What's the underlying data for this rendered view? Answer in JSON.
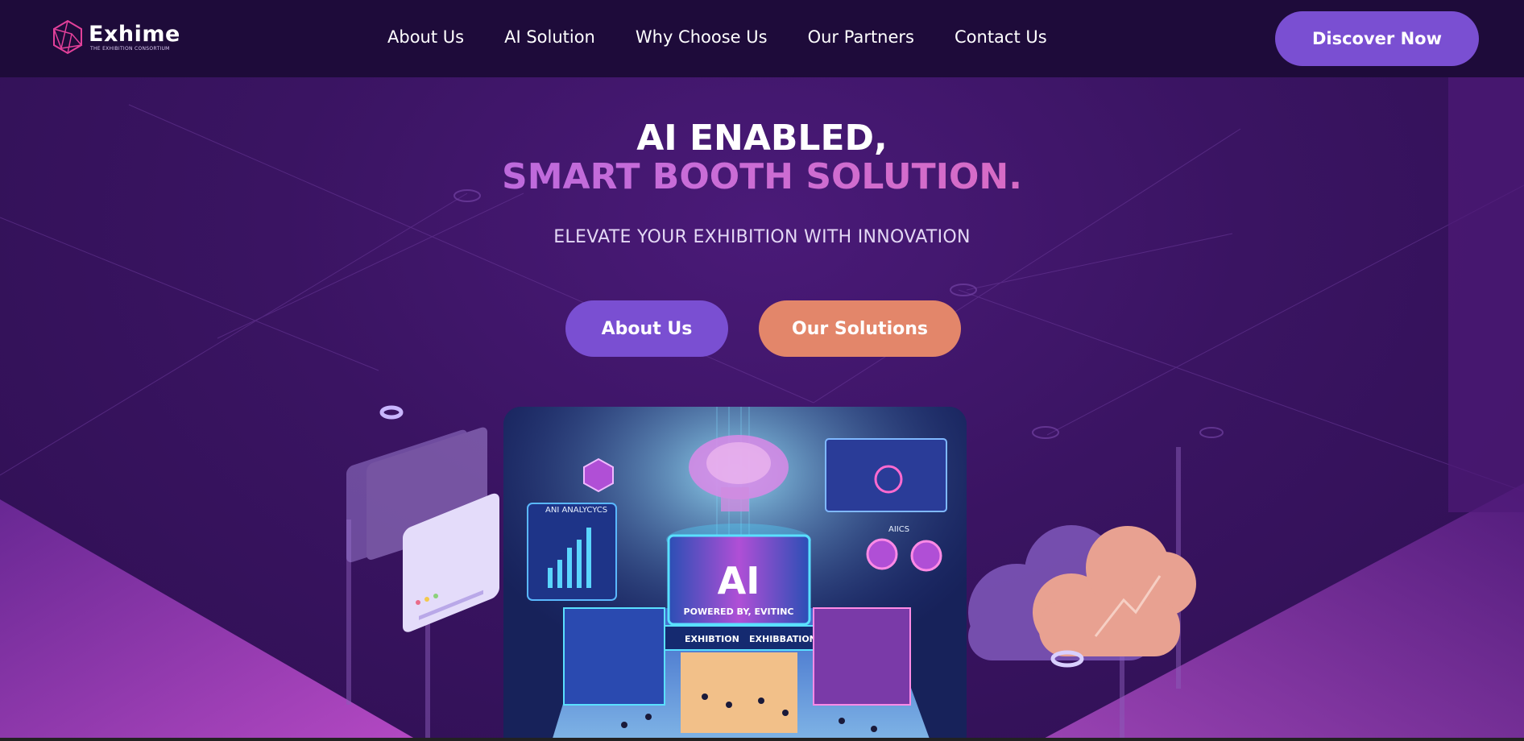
{
  "logo": {
    "name": "Exhime",
    "tagline": "THE EXHIBITION CONSORTIUM"
  },
  "nav": {
    "items": [
      "About Us",
      "AI Solution",
      "Why Choose Us",
      "Our Partners",
      "Contact Us"
    ],
    "cta": "Discover Now"
  },
  "hero": {
    "line1": "AI ENABLED,",
    "line2": "SMART BOOTH SOLUTION.",
    "subtitle": "ELEVATE YOUR EXHIBITION WITH INNOVATION",
    "btn_about": "About Us",
    "btn_solutions": "Our Solutions"
  },
  "illustration": {
    "center_label": "AI",
    "powered": "POWERED BY, EVITINC",
    "sign_left": "EXHIBTION",
    "sign_right": "EXHIBBATION",
    "panel_left": "ANI ANALYCYCS",
    "panel_right": "AIICS"
  },
  "colors": {
    "accent": "#7a4fd2",
    "secondary": "#e3866a",
    "header_bg": "#1e0b3a"
  }
}
